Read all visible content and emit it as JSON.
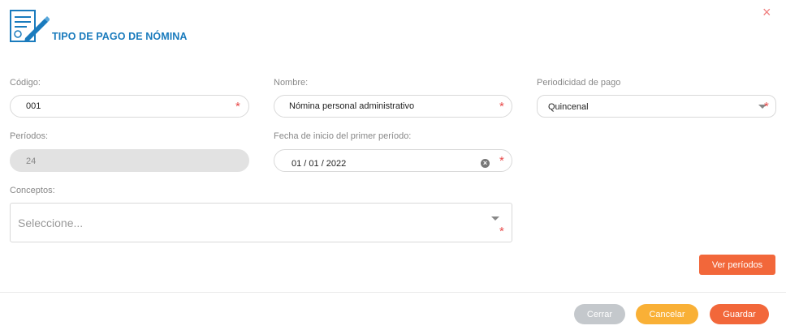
{
  "header": {
    "title": "TIPO DE PAGO DE NÓMINA",
    "close_glyph": "×",
    "icon": "document-edit-icon"
  },
  "form": {
    "codigo": {
      "label": "Código:",
      "value": "001",
      "required_mark": "*"
    },
    "nombre": {
      "label": "Nombre:",
      "value": "Nómina personal administrativo",
      "required_mark": "*"
    },
    "periodicidad": {
      "label": "Periodicidad de pago",
      "selected": "Quincenal",
      "required_mark": "*"
    },
    "periodos": {
      "label": "Períodos:",
      "value": "24"
    },
    "fecha_inicio": {
      "label": "Fecha de inicio del primer período:",
      "value": "01 / 01 / 2022",
      "required_mark": "*"
    },
    "conceptos": {
      "label": "Conceptos:",
      "placeholder": "Seleccione...",
      "required_mark": "*"
    }
  },
  "actions": {
    "ver_periodos": "Ver períodos",
    "cerrar": "Cerrar",
    "cancelar": "Cancelar",
    "guardar": "Guardar"
  },
  "colors": {
    "title": "#1a7bbd",
    "required": "#e84a4a",
    "primary_button": "#f2673a",
    "cancel_button": "#f9b036",
    "close_button": "#c4c8cc"
  }
}
